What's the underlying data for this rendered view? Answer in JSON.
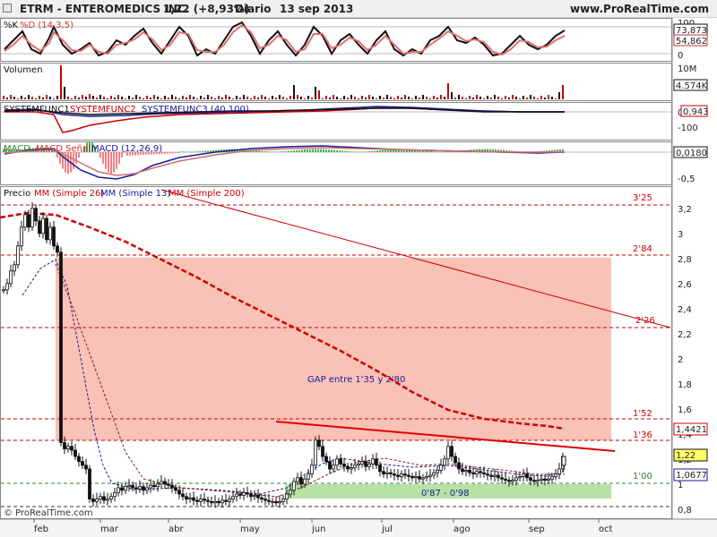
{
  "header": {
    "symbol": "ETRM - ENTEROMEDICS INC.",
    "change": "1,22 (+8,93%)",
    "period": "Diario",
    "date": "13 sep 2013",
    "site": "www.ProRealTime.com"
  },
  "copyright": "© ProRealTime.com",
  "colors": {
    "red": "#cc0000",
    "blue": "#1a1a99",
    "gap_fill": "#f9c2b6",
    "support_fill": "#b5e3a5",
    "candle": "#111111",
    "panel_bg": "#ffffff",
    "grid": "#dcdcdc"
  },
  "panels": {
    "stoch": {
      "label": "%K %D (14,3,5)",
      "labels": {
        "k": "%K",
        "d": "%D (14,3,5)"
      },
      "top_tick": "100",
      "value_boxes": [
        "73,873",
        "54,862"
      ],
      "zero": "0"
    },
    "volume": {
      "label": "Volumen",
      "ticks": [
        "10M"
      ],
      "value_box": "4.574K"
    },
    "systemfunc": {
      "label": "SYSTEMFUNC1 SYSTEMFUNC2 SYSTEMFUNC3 (40,100)",
      "labels": {
        "f1": "SYSTEMFUNC1",
        "f2": "SYSTEMFUNC2",
        "f3": "SYSTEMFUNC3 (40,100)"
      },
      "zero": "0",
      "value_box": "0,943",
      "ticks": [
        "-100"
      ]
    },
    "macd": {
      "label": "MACD MACD Señal MACD (12,26,9)",
      "labels": {
        "a": "MACD",
        "b": "MACD Señal",
        "c": "MACD (12,26,9)"
      },
      "value_box": "0,0180",
      "ticks": [
        "-0,5"
      ]
    },
    "price": {
      "label": "Precio MM (Simple 26) MM (Simple 13) MM (Simple 200)",
      "labels": {
        "precio": "Precio",
        "mm26": "MM (Simple 26)",
        "mm13": "MM (Simple 13)",
        "mm200": "MM (Simple 200)"
      },
      "y_ticks": [
        "3,2",
        "3",
        "2,8",
        "2,6",
        "2,4",
        "2,2",
        "2",
        "1,8",
        "1,6",
        "1,4",
        "1,2",
        "1",
        "0,8"
      ],
      "value_boxes": [
        "1,4421",
        "1,22",
        "1,0677"
      ]
    }
  },
  "chart_data": {
    "type": "candlestick",
    "x_labels": [
      "feb",
      "mar",
      "abr",
      "may",
      "jun",
      "jul",
      "ago",
      "sep",
      "oct"
    ],
    "ylim": [
      0.78,
      3.3
    ],
    "horizontal_levels": [
      {
        "label": "3'25",
        "value": 3.25
      },
      {
        "label": "2'84",
        "value": 2.84
      },
      {
        "label": "2'26",
        "value": 2.26
      },
      {
        "label": "1'52",
        "value": 1.52
      },
      {
        "label": "1'36",
        "value": 1.36
      },
      {
        "label": "1'00",
        "value": 1.0
      },
      {
        "label": "",
        "value": 0.82
      }
    ],
    "zones": [
      {
        "label": "GAP entre 1'35 y 2'80",
        "from": 1.35,
        "to": 2.8
      },
      {
        "label": "0'87 - 0'98",
        "from": 0.87,
        "to": 0.98
      }
    ],
    "last_close": 1.22
  }
}
